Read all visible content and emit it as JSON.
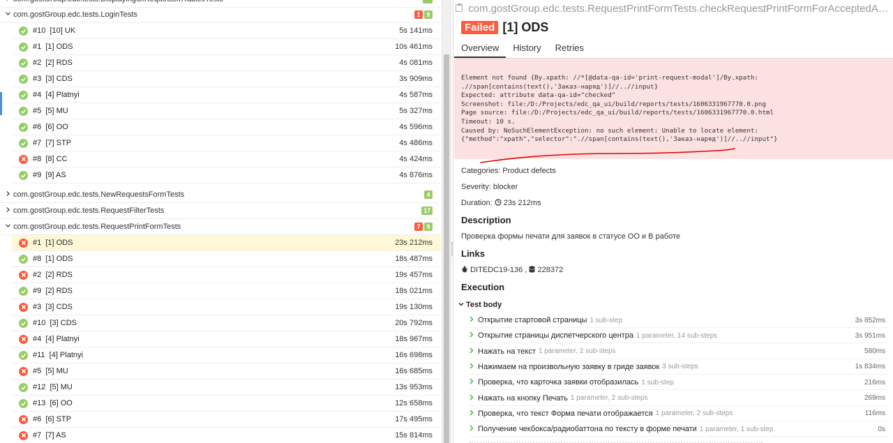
{
  "left_pane": {
    "top_cut_group": "com.gostGroup.edc.tests.DisplayingOfRequestsInTablesTests",
    "groups": [
      {
        "name": "com.gostGroup.edc.tests.LoginTests",
        "expanded": true,
        "failed_badge": "1",
        "passed_badge": "9",
        "tests": [
          {
            "status": "passed",
            "name": "#10  [10] UK",
            "duration": "5s 141ms"
          },
          {
            "status": "passed",
            "name": "#1  [1] ODS",
            "duration": "10s 461ms"
          },
          {
            "status": "passed",
            "name": "#2  [2] RDS",
            "duration": "4s 081ms"
          },
          {
            "status": "passed",
            "name": "#3  [3] CDS",
            "duration": "3s 909ms"
          },
          {
            "status": "passed",
            "name": "#4  [4] Platnyi",
            "duration": "4s 587ms"
          },
          {
            "status": "passed",
            "name": "#5  [5] MU",
            "duration": "5s 327ms"
          },
          {
            "status": "passed",
            "name": "#6  [6] OO",
            "duration": "4s 596ms"
          },
          {
            "status": "passed",
            "name": "#7  [7] STP",
            "duration": "4s 486ms"
          },
          {
            "status": "failed",
            "name": "#8  [8] CC",
            "duration": "4s 424ms"
          },
          {
            "status": "passed",
            "name": "#9  [9] AS",
            "duration": "4s 876ms"
          }
        ]
      },
      {
        "name": "com.gostGroup.edc.tests.NewRequestsFormTests",
        "expanded": false,
        "passed_badge": "4"
      },
      {
        "name": "com.gostGroup.edc.tests.RequestFilterTests",
        "expanded": false,
        "passed_badge": "17"
      },
      {
        "name": "com.gostGroup.edc.tests.RequestPrintFormTests",
        "expanded": true,
        "failed_badge": "7",
        "passed_badge": "9",
        "tests": [
          {
            "status": "failed",
            "name": "#1  [1] ODS",
            "duration": "23s 212ms",
            "selected": true
          },
          {
            "status": "passed",
            "name": "#8  [1] ODS",
            "duration": "18s 487ms"
          },
          {
            "status": "failed",
            "name": "#2  [2] RDS",
            "duration": "19s 457ms"
          },
          {
            "status": "passed",
            "name": "#9  [2] RDS",
            "duration": "18s 021ms"
          },
          {
            "status": "failed",
            "name": "#3  [3] CDS",
            "duration": "19s 130ms"
          },
          {
            "status": "passed",
            "name": "#10  [3] CDS",
            "duration": "20s 792ms"
          },
          {
            "status": "failed",
            "name": "#4  [4] Platnyi",
            "duration": "18s 967ms"
          },
          {
            "status": "passed",
            "name": "#11  [4] Platnyi",
            "duration": "16s 698ms"
          },
          {
            "status": "failed",
            "name": "#5  [5] MU",
            "duration": "16s 685ms"
          },
          {
            "status": "passed",
            "name": "#12  [5] MU",
            "duration": "13s 953ms"
          },
          {
            "status": "passed",
            "name": "#13  [6] OO",
            "duration": "12s 658ms"
          },
          {
            "status": "failed",
            "name": "#6  [6] STP",
            "duration": "17s 495ms"
          },
          {
            "status": "failed",
            "name": "#7  [7] AS",
            "duration": "15s 814ms"
          }
        ]
      }
    ]
  },
  "detail": {
    "full_name": "com.gostGroup.edc.tests.RequestPrintFormTests.checkRequestPrintFormForAcceptedAndInWorkSt...",
    "status_label": "Failed",
    "title": "[1] ODS",
    "tabs": [
      "Overview",
      "History",
      "Retries"
    ],
    "error_message": "Element not found {By.xpath: //*[@data-qa-id='print-request-modal']/By.xpath:\n.//span[contains(text(),'Заказ-наряд')]//..//input}\nExpected: attribute data-qa-id=\"checked\"\nScreenshot: file:/D:/Projects/edc_qa_ui/build/reports/tests/1606331967770.0.png\nPage source: file:/D:/Projects/edc_qa_ui/build/reports/tests/1606331967770.0.html\nTimeout: 10 s.\nCaused by: NoSuchElementException: no such element: Unable to locate element:\n{\"method\":\"xpath\",\"selector\":\".//span[contains(text(),'Заказ-наряд')]//..//input\"}",
    "categories": "Categories: Product defects",
    "severity": "Severity: blocker",
    "duration_label": "Duration:",
    "duration_value": "23s 212ms",
    "description_heading": "Description",
    "description_text": "Проверка формы печати для заявок в статусе ОО и В работе",
    "links_heading": "Links",
    "link_issue": "DITEDC19-136",
    "link_sep": ",",
    "link_tms": "228372",
    "execution_heading": "Execution",
    "test_body_label": "Test body",
    "steps": [
      {
        "name": "Открытие стартовой страницы",
        "meta": "1 sub-step",
        "duration": "3s 852ms"
      },
      {
        "name": "Открытие страницы диспетчерского центра",
        "meta": "1 parameter, 14 sub-steps",
        "duration": "3s 951ms"
      },
      {
        "name": "Нажать на текст",
        "meta": "1 parameter, 2 sub-steps",
        "duration": "580ms"
      },
      {
        "name": "Нажимаем на произвольную заявку в гриде заявок",
        "meta": "3 sub-steps",
        "duration": "1s 834ms"
      },
      {
        "name": "Проверка, что карточка заявки отобразилась",
        "meta": "1 sub-step",
        "duration": "216ms"
      },
      {
        "name": "Нажать на кнопку Печать",
        "meta": "1 parameter, 2 sub-steps",
        "duration": "269ms"
      },
      {
        "name": "Проверка, что текст Форма печати отображается",
        "meta": "1 parameter, 2 sub-steps",
        "duration": "116ms"
      },
      {
        "name": "Получение чекбокса/радиобаттона по тексту в форме печати",
        "meta": "1 parameter, 1 sub-step",
        "duration": "0s"
      }
    ]
  },
  "colors": {
    "failed": "#fd5a3e",
    "passed": "#97cc64",
    "error_bg": "#fce1e1",
    "selected_bg": "#fff8d6",
    "annotation": "#e00000"
  }
}
